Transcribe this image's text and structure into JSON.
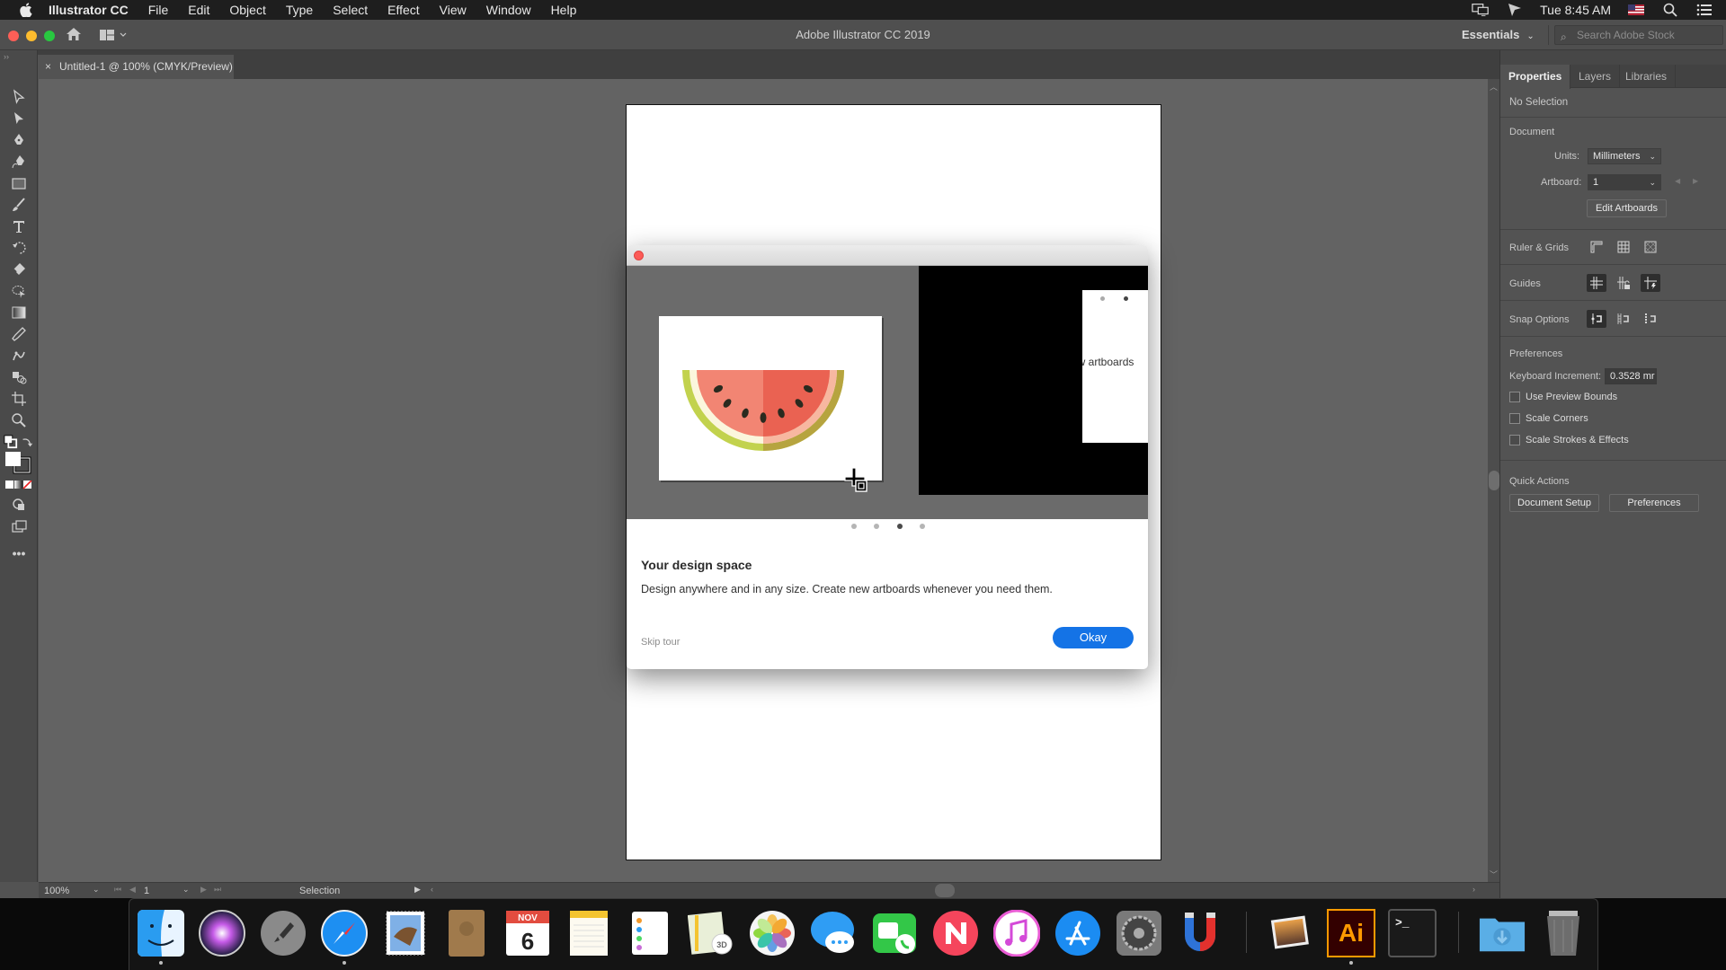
{
  "menubar": {
    "app_name": "Illustrator CC",
    "items": [
      "File",
      "Edit",
      "Object",
      "Type",
      "Select",
      "Effect",
      "View",
      "Window",
      "Help"
    ],
    "clock": "Tue 8:45 AM",
    "status_icons": [
      "display-mirroring-icon",
      "cursor-pointer-icon",
      "us-flag-icon",
      "spotlight-search-icon",
      "notification-center-icon"
    ]
  },
  "appbar": {
    "title": "Adobe Illustrator CC 2019",
    "workspace": "Essentials",
    "stock_search_placeholder": "Search Adobe Stock"
  },
  "document_tab": {
    "close_glyph": "×",
    "label": "Untitled-1 @ 100% (CMYK/Preview)"
  },
  "tools": [
    "selection-tool",
    "direct-selection-tool",
    "pen-tool",
    "curvature-tool",
    "rectangle-tool",
    "paintbrush-tool",
    "type-tool",
    "rotate-tool",
    "eraser-tool",
    "shape-builder-tool",
    "gradient-tool",
    "eyedropper-tool",
    "puppet-warp-tool",
    "blend-tool",
    "artboard-tool",
    "zoom-tool",
    "default-fill-stroke",
    "swap-fill-stroke",
    "fill-stroke-swatches",
    "color-none-modes",
    "draw-mode",
    "screen-mode",
    "edit-toolbar"
  ],
  "statusbar": {
    "zoom": "100%",
    "artboard": "1",
    "current_tool": "Selection"
  },
  "properties_panel": {
    "tabs": [
      {
        "label": "Properties",
        "active": true
      },
      {
        "label": "Layers",
        "active": false
      },
      {
        "label": "Libraries",
        "active": false
      }
    ],
    "selection_state": "No Selection",
    "document": {
      "heading": "Document",
      "units_label": "Units:",
      "units_value": "Millimeters",
      "artboard_label": "Artboard:",
      "artboard_value": "1",
      "edit_artboards_label": "Edit Artboards"
    },
    "ruler_grids_label": "Ruler & Grids",
    "guides_label": "Guides",
    "snap_options_label": "Snap Options",
    "preferences": {
      "heading": "Preferences",
      "keyboard_increment_label": "Keyboard Increment:",
      "keyboard_increment_value": "0.3528 mr",
      "checkboxes": [
        {
          "label": "Use Preview Bounds",
          "checked": false
        },
        {
          "label": "Scale Corners",
          "checked": false
        },
        {
          "label": "Scale Strokes & Effects",
          "checked": false
        }
      ]
    },
    "quick_actions": {
      "heading": "Quick Actions",
      "document_setup_label": "Document Setup",
      "preferences_label": "Preferences"
    }
  },
  "dialog": {
    "heading": "Your design space",
    "body": "Design anywhere and in any size. Create new artboards whenever you need them.",
    "skip_label": "Skip tour",
    "okay_label": "Okay",
    "carousel": {
      "total": 4,
      "active_index": 2
    },
    "peek_text": "ew artboards",
    "accent_color": "#1473e6"
  },
  "dock": {
    "apps": [
      {
        "name": "Finder",
        "running": true
      },
      {
        "name": "Siri",
        "running": false
      },
      {
        "name": "Launchpad",
        "running": false
      },
      {
        "name": "Safari",
        "running": true
      },
      {
        "name": "Mail",
        "running": false
      },
      {
        "name": "Contacts",
        "running": false
      },
      {
        "name": "Calendar",
        "running": false,
        "month": "NOV",
        "day": "6"
      },
      {
        "name": "Notes",
        "running": false
      },
      {
        "name": "Reminders",
        "running": false
      },
      {
        "name": "Maps",
        "running": false
      },
      {
        "name": "Photos",
        "running": false
      },
      {
        "name": "Messages",
        "running": false
      },
      {
        "name": "FaceTime",
        "running": false
      },
      {
        "name": "News",
        "running": false
      },
      {
        "name": "iTunes",
        "running": false
      },
      {
        "name": "App Store",
        "running": false
      },
      {
        "name": "System Preferences",
        "running": false
      },
      {
        "name": "Magnet",
        "running": false
      },
      {
        "name": "Preview",
        "running": false
      },
      {
        "name": "Adobe Illustrator",
        "running": true,
        "glyph": "Ai"
      },
      {
        "name": "Terminal",
        "running": false,
        "glyph": ">_"
      },
      {
        "name": "Downloads",
        "running": false
      },
      {
        "name": "Trash",
        "running": false
      }
    ]
  }
}
